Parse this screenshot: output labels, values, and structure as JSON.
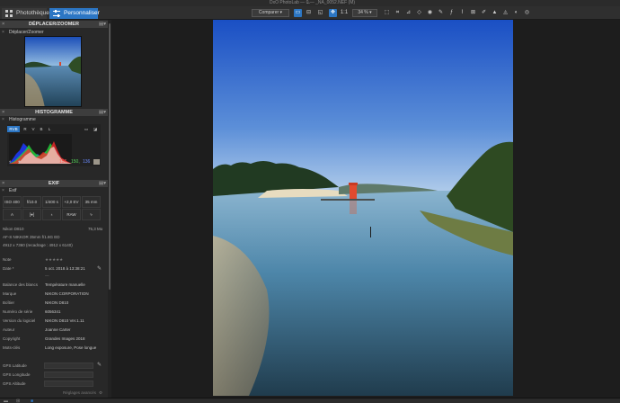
{
  "window": {
    "title": "DxO PhotoLab — 0̶̶ — _NA_0052.NEF (M)"
  },
  "tabs": [
    {
      "label": "Photothèque",
      "active": false
    },
    {
      "label": "Personnaliser",
      "active": true
    }
  ],
  "toolbar": {
    "compare_label": "Comparer",
    "one_to_one": "1:1",
    "zoom": "34 %"
  },
  "panels": {
    "nav": {
      "title": "DÉPLACER/ZOOMER",
      "subtitle": "Déplacer/Zoomer"
    },
    "histogram": {
      "title": "HISTOGRAMME",
      "subtitle": "Histogramme",
      "channels": [
        "RVB",
        "R",
        "V",
        "B",
        "L"
      ],
      "active_channel": "RVB",
      "rgb_r": "156,",
      "rgb_g": "150,",
      "rgb_b": "136"
    },
    "exif": {
      "title": "EXIF",
      "subtitle": "Exif",
      "grid_row1": [
        "ISO 400",
        "f/10.0",
        "1/400 s",
        "+2,0 EV",
        "35 mm"
      ],
      "grid_row2_text": "A",
      "grid_row2_raw": "RAW",
      "camera": "Nikon D810",
      "file_size": "75,3 Mo",
      "lens": "AF-S NIKKOR 35mm f/1.8G ED",
      "dimensions": "4912 x 7360 (recadrage : 4912 x 6140)",
      "note_label": "Note",
      "date_label": "Date *",
      "date_value": "5 oct. 2018 à 13:38:21",
      "fields": [
        {
          "label": "Balance des blancs",
          "value": "Température manuelle"
        },
        {
          "label": "Marque",
          "value": "NIKON CORPORATION"
        },
        {
          "label": "Boîtier",
          "value": "NIKON D810"
        },
        {
          "label": "Numéro de série",
          "value": "6056341"
        },
        {
          "label": "Version du logiciel",
          "value": "NIKON D810 Ver.1.11"
        },
        {
          "label": "Auteur",
          "value": "Joanne Carter"
        },
        {
          "label": "Copyright",
          "value": "Grandes Images 2018"
        },
        {
          "label": "Mots-clés",
          "value": "Long exposure, Pose longue"
        }
      ],
      "gps": [
        {
          "label": "GPS Latitude"
        },
        {
          "label": "GPS Longitude"
        },
        {
          "label": "GPS Altitude"
        }
      ],
      "footer": "Réglages avancés"
    }
  },
  "colors": {
    "accent": "#2c76c4",
    "panel_bg": "#282828",
    "header_bg": "#3d3d3d"
  }
}
